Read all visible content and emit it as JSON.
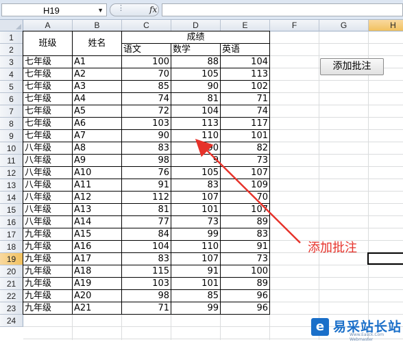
{
  "formula_bar": {
    "name_box": "H19",
    "fx_label": "fx",
    "formula": ""
  },
  "columns": [
    "A",
    "B",
    "C",
    "D",
    "E",
    "F",
    "G",
    "H"
  ],
  "selected_column": "H",
  "rows": [
    "1",
    "2",
    "3",
    "4",
    "5",
    "6",
    "7",
    "8",
    "9",
    "10",
    "11",
    "12",
    "13",
    "14",
    "15",
    "16",
    "17",
    "18",
    "19",
    "20",
    "21",
    "22",
    "23",
    "24"
  ],
  "selected_row": "19",
  "header": {
    "class_label": "班级",
    "name_label": "姓名",
    "scores_label": "成绩",
    "chinese_label": "语文",
    "math_label": "数学",
    "english_label": "英语"
  },
  "students": [
    {
      "grade": "七年级",
      "name": "A1",
      "chinese": "100",
      "math": "88",
      "english": "104"
    },
    {
      "grade": "七年级",
      "name": "A2",
      "chinese": "70",
      "math": "105",
      "english": "113"
    },
    {
      "grade": "七年级",
      "name": "A3",
      "chinese": "85",
      "math": "90",
      "english": "102"
    },
    {
      "grade": "七年级",
      "name": "A4",
      "chinese": "74",
      "math": "81",
      "english": "71"
    },
    {
      "grade": "七年级",
      "name": "A5",
      "chinese": "72",
      "math": "104",
      "english": "74"
    },
    {
      "grade": "七年级",
      "name": "A6",
      "chinese": "103",
      "math": "113",
      "english": "117"
    },
    {
      "grade": "七年级",
      "name": "A7",
      "chinese": "90",
      "math": "110",
      "english": "101"
    },
    {
      "grade": "八年级",
      "name": "A8",
      "chinese": "83",
      "math": "90",
      "english": "82"
    },
    {
      "grade": "八年级",
      "name": "A9",
      "chinese": "98",
      "math": "9",
      "english": "73"
    },
    {
      "grade": "八年级",
      "name": "A10",
      "chinese": "76",
      "math": "105",
      "english": "107"
    },
    {
      "grade": "八年级",
      "name": "A11",
      "chinese": "91",
      "math": "83",
      "english": "109"
    },
    {
      "grade": "八年级",
      "name": "A12",
      "chinese": "112",
      "math": "107",
      "english": "70"
    },
    {
      "grade": "八年级",
      "name": "A13",
      "chinese": "81",
      "math": "101",
      "english": "107"
    },
    {
      "grade": "八年级",
      "name": "A14",
      "chinese": "77",
      "math": "73",
      "english": "89"
    },
    {
      "grade": "九年级",
      "name": "A15",
      "chinese": "84",
      "math": "99",
      "english": "83"
    },
    {
      "grade": "九年级",
      "name": "A16",
      "chinese": "104",
      "math": "110",
      "english": "91"
    },
    {
      "grade": "九年级",
      "name": "A17",
      "chinese": "83",
      "math": "107",
      "english": "73"
    },
    {
      "grade": "九年级",
      "name": "A18",
      "chinese": "115",
      "math": "91",
      "english": "100"
    },
    {
      "grade": "九年级",
      "name": "A19",
      "chinese": "103",
      "math": "101",
      "english": "89"
    },
    {
      "grade": "九年级",
      "name": "A20",
      "chinese": "98",
      "math": "85",
      "english": "96"
    },
    {
      "grade": "九年级",
      "name": "A21",
      "chinese": "71",
      "math": "99",
      "english": "96"
    }
  ],
  "button": {
    "label": "添加批注"
  },
  "annotation": {
    "text": "添加批注",
    "color": "#e6322a"
  },
  "watermark": {
    "logo_icon": "e-logo-icon",
    "logo_glyph": "e",
    "name": "易采站长站",
    "url": "Www.Easck.Com Webmaster"
  }
}
